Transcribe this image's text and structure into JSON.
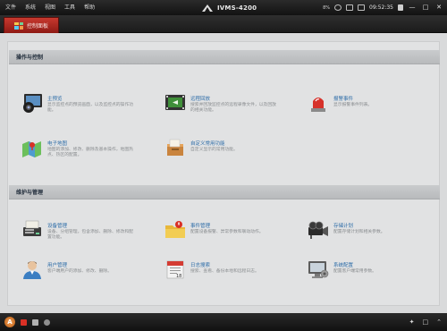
{
  "menu": [
    "文件",
    "系统",
    "视图",
    "工具",
    "帮助"
  ],
  "app_title": "IVMS-4200",
  "tray": {
    "cpu": "8%",
    "clock": "09:52:35"
  },
  "window_controls": [
    "minimize-icon",
    "restore-icon",
    "close-icon"
  ],
  "tab": {
    "label": "控制面板"
  },
  "sections": {
    "operate": "操作与控制",
    "maintain": "维护与管理"
  },
  "items": [
    {
      "name": "主预览",
      "desc": "显示监控点的预览画面，以及监控点的操作功能。",
      "icon": "monitor-preview-icon"
    },
    {
      "name": "远程回放",
      "desc": "搜索并回放监控点的远程录像文件，以及回放的相关功能。",
      "icon": "film-playback-icon"
    },
    {
      "name": "报警事件",
      "desc": "显示报警事件列表。",
      "icon": "alarm-siren-icon"
    },
    {
      "name": "电子地图",
      "desc": "地图的添加、修改、删除及基本操作，地图热点、热区的配置。",
      "icon": "emap-icon"
    },
    {
      "name": "自定义常用功能",
      "desc": "自定义显示的常用功能。",
      "icon": "custom-functions-icon"
    },
    {
      "name": "设备管理",
      "desc": "设备、分组管理，包含添加、删除、修改和配置功能。",
      "icon": "device-management-icon"
    },
    {
      "name": "事件管理",
      "desc": "配置设备报警、异常参数和联动动作。",
      "icon": "event-management-icon"
    },
    {
      "name": "存储计划",
      "desc": "配置存储计划和相关参数。",
      "icon": "storage-schedule-icon"
    },
    {
      "name": "用户管理",
      "desc": "客户端用户的添加、修改、删除。",
      "icon": "user-management-icon"
    },
    {
      "name": "日志搜索",
      "desc": "搜索、查看、备份本地和远程日志。",
      "icon": "log-search-icon"
    },
    {
      "name": "系统配置",
      "desc": "配置客户端常用参数。",
      "icon": "system-config-icon"
    }
  ],
  "bottom_icons": [
    "app-logo-icon",
    "alarm-indicator-icon",
    "record-icon",
    "speaker-icon",
    "pin-icon",
    "screen-icon",
    "collapse-icon"
  ],
  "colors": {
    "accent_red": "#b3261e",
    "link_blue": "#2d6da8"
  }
}
